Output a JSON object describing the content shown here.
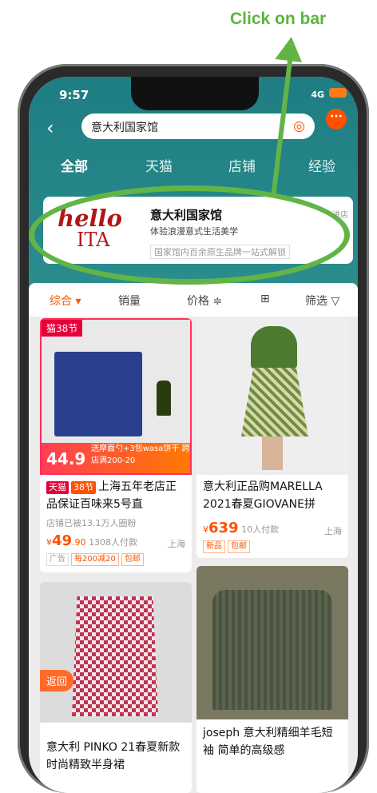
{
  "annotation": {
    "text": "Click on bar"
  },
  "status": {
    "time": "9:57",
    "network": "4G"
  },
  "search": {
    "query": "意大利国家馆"
  },
  "tabs": [
    {
      "label": "全部"
    },
    {
      "label": "天猫"
    },
    {
      "label": "店铺"
    },
    {
      "label": "经验"
    }
  ],
  "shop": {
    "logo_line1": "hello",
    "logo_line2": "ITA",
    "name": "意大利国家馆",
    "desc": "体验浪漫意式生活美学",
    "tag": "国家馆内百余原生品牌一站式解锁",
    "side": "进店"
  },
  "filters": [
    {
      "label": "综合 ▾"
    },
    {
      "label": "销量"
    },
    {
      "label": "价格 ≑"
    },
    {
      "label": "⊞"
    },
    {
      "label": "筛选 ▽"
    }
  ],
  "products": [
    {
      "badge": "猫38节",
      "img_price": "44.9",
      "img_promo": "送摩面勺+3包wasa饼干 跨店满200-20",
      "tag1": "天猫",
      "tag2": "38节",
      "title": "上海五年老店正品保证百味来5号直",
      "shop_fans": "店铺已被13.1万人圈粉",
      "price": "49",
      "price_decimal": ".90",
      "pay": "1308人付款",
      "location": "上海",
      "ptags": [
        "广告",
        "每200减20",
        "包邮"
      ]
    },
    {
      "title": "意大利正品购MARELLA 2021春夏GIOVANE拼",
      "price": "639",
      "pay": "10人付款",
      "location": "上海",
      "ptags": [
        "新品",
        "包邮"
      ]
    },
    {
      "back": "返回",
      "title": "意大利 PINKO 21春夏新款时尚精致半身裙"
    },
    {
      "title": "joseph 意大利精细羊毛短袖 简单的高级感"
    }
  ],
  "colors": {
    "accent": "#ff5000",
    "teal": "#1e7d83",
    "annotation": "#63b446"
  }
}
